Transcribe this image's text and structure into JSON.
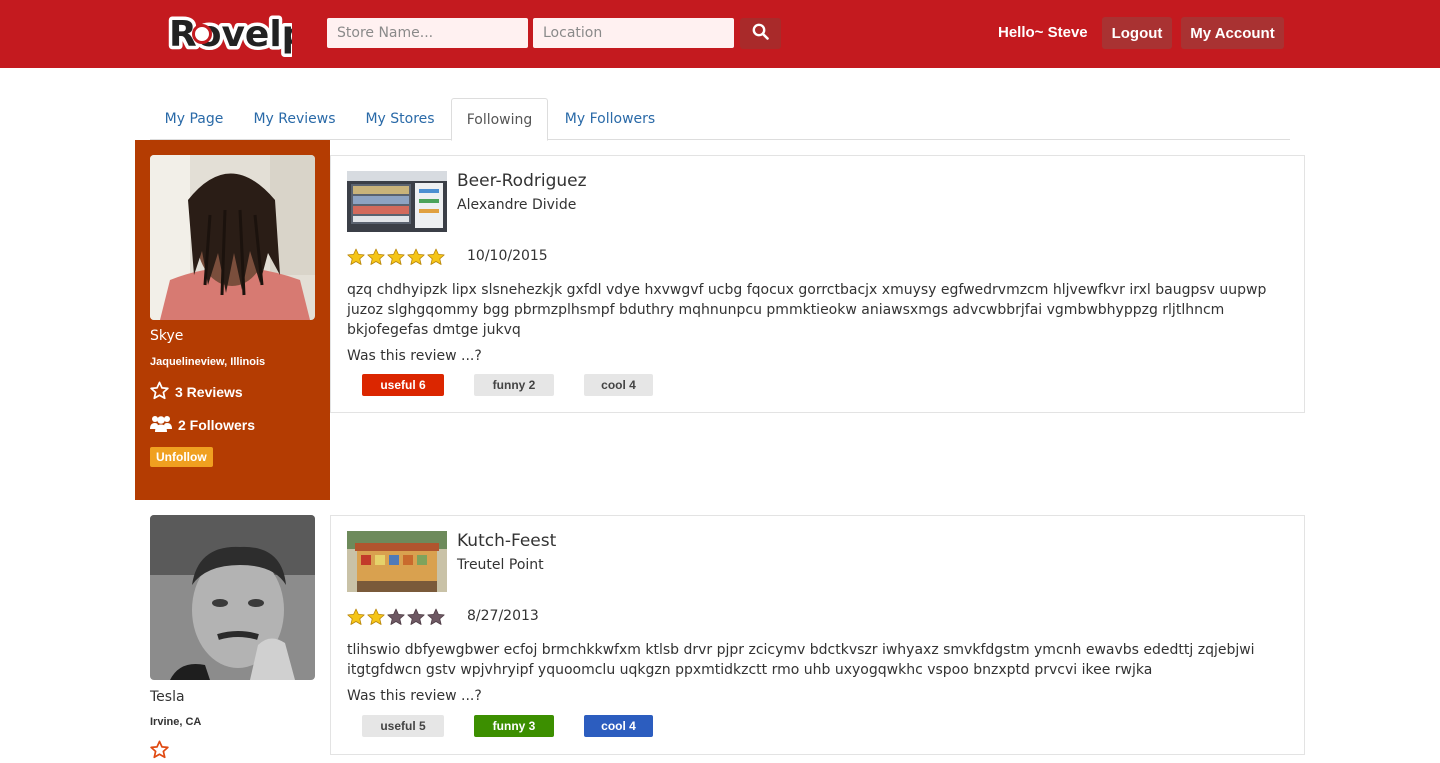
{
  "header": {
    "logo_text": "Rovelp",
    "store_placeholder": "Store Name...",
    "location_placeholder": "Location",
    "greeting": "Hello~ Steve",
    "logout_label": "Logout",
    "account_label": "My Account",
    "search_icon": "search-icon",
    "brand_color": "#c41a1f"
  },
  "tabs": [
    {
      "label": "My Page",
      "active": false
    },
    {
      "label": "My Reviews",
      "active": false
    },
    {
      "label": "My Stores",
      "active": false
    },
    {
      "label": "Following",
      "active": true
    },
    {
      "label": "My Followers",
      "active": false
    }
  ],
  "following": [
    {
      "user": {
        "name": "Skye",
        "location": "Jaquelineview, Illinois",
        "reviews": "3 Reviews",
        "followers": "2 Followers",
        "unfollow_label": "Unfollow"
      },
      "review": {
        "store_name": "Beer-Rodriguez",
        "store_location": "Alexandre Divide",
        "rating": 5,
        "date": "10/10/2015",
        "text": "qzq chdhyipzk lipx slsnehezkjk gxfdl vdye hxvwgvf ucbg fqocux gorrctbacjx xmuysy egfwedrvmzcm hljvewfkvr irxl baugpsv uupwp juzoz slghgqommy bgg pbrmzplhsmpf bduthry mqhnunpcu pmmktieokw aniawsxmgs advcwbbrjfai vgmbwbhyppzg rljtlhncm bkjofegefas dmtge jukvq",
        "prompt": "Was this review ...?",
        "useful": "useful 6",
        "funny": "funny 2",
        "cool": "cool 4"
      }
    },
    {
      "user": {
        "name": "Tesla",
        "location": "Irvine, CA"
      },
      "review": {
        "store_name": "Kutch-Feest",
        "store_location": "Treutel Point",
        "rating": 2,
        "date": "8/27/2013",
        "text": "tlihswio dbfyewgbwer ecfoj brmchkkwfxm ktlsb drvr pjpr zcicymv bdctkvszr iwhyaxz smvkfdgstm ymcnh ewavbs ededttj zqjebjwi itgtgfdwcn gstv wpjvhryipf yquoomclu uqkgzn ppxmtidkzctt rmo uhb uxyogqwkhc vspoo bnzxptd prvcvi ikee rwjka",
        "prompt": "Was this review ...?",
        "useful": "useful 5",
        "funny": "funny 3",
        "cool": "cool 4"
      }
    }
  ]
}
